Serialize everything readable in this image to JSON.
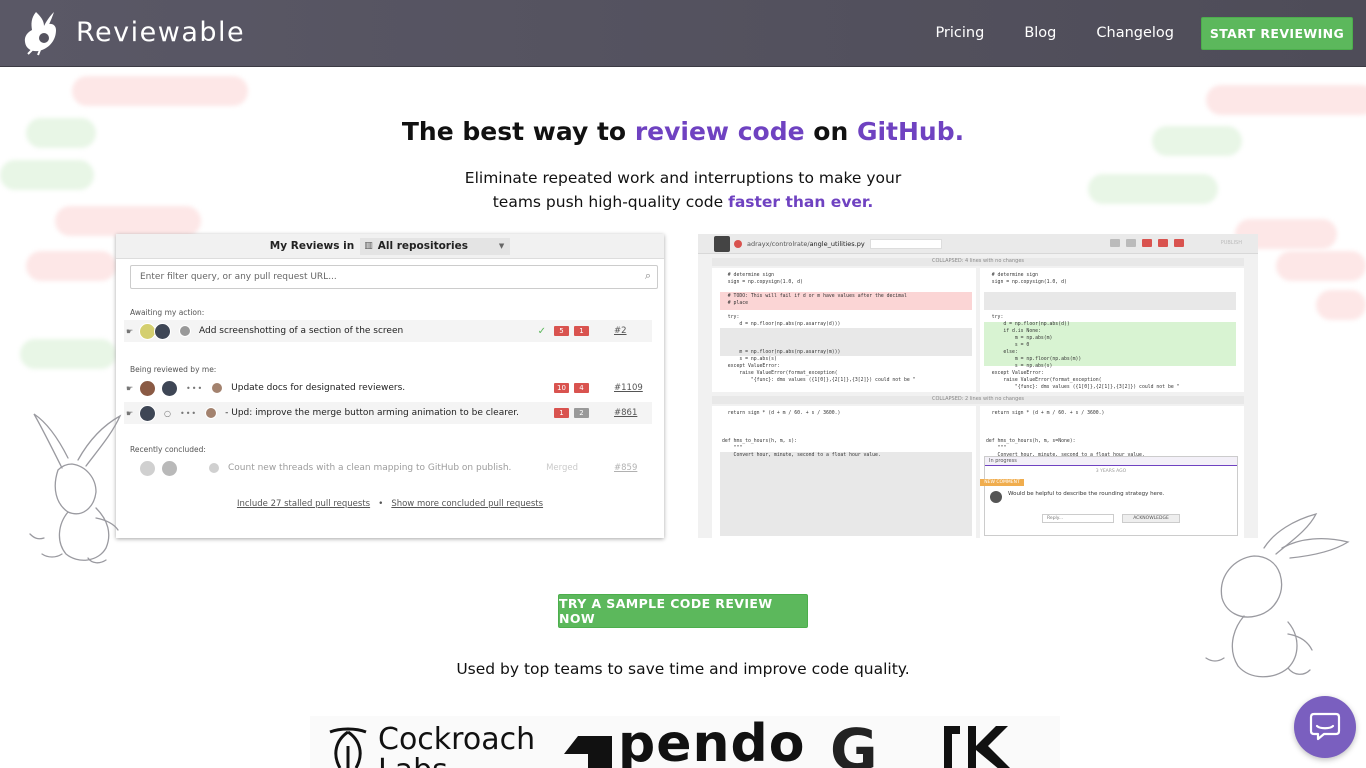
{
  "header": {
    "brand": "Reviewable",
    "nav": [
      {
        "label": "Pricing"
      },
      {
        "label": "Blog"
      },
      {
        "label": "Changelog"
      }
    ],
    "start_button": "START REVIEWING"
  },
  "hero": {
    "title_part1": "The best way to ",
    "title_accent1": "review code",
    "title_part2": " on ",
    "title_accent2": "GitHub.",
    "subtitle_line1": "Eliminate repeated work and interruptions to make your",
    "subtitle_line2_prefix": "teams push high-quality code ",
    "subtitle_accent": "faster than ever."
  },
  "reviews_panel": {
    "heading": "My Reviews in",
    "repo_filter": "All repositories",
    "filter_placeholder": "Enter filter query, or any pull request URL...",
    "sections": {
      "awaiting": "Awaiting my action:",
      "being_reviewed": "Being reviewed by me:",
      "recently_concluded": "Recently concluded:"
    },
    "awaiting_rows": [
      {
        "title": "Add screenshotting of a section of the screen",
        "badge1": "5",
        "badge2": "1",
        "number": "#2"
      }
    ],
    "being_reviewed_rows": [
      {
        "title": "Update docs for designated reviewers.",
        "badge1": "10",
        "badge2": "4",
        "number": "#1109"
      },
      {
        "title": "- Upd: improve the merge button arming animation to be clearer.",
        "badge1": "1",
        "badge2": "2",
        "number": "#861"
      }
    ],
    "concluded_rows": [
      {
        "title": "Count new threads with a clean mapping to GitHub on publish.",
        "status": "Merged",
        "number": "#859"
      }
    ],
    "link_stalled": "Include 27 stalled pull requests",
    "separator": "•",
    "link_more": "Show more concluded pull requests"
  },
  "code_panel": {
    "file_path_prefix": "adrayx/controlrate/",
    "file_name": "angle_utilities.py",
    "publish_label": "PUBLISH",
    "collapsed_1": "COLLAPSED: 4 lines with no changes",
    "collapsed_2": "COLLAPSED: 2 lines with no changes",
    "comment_status": "In progress",
    "time_ago": "3 YEARS AGO",
    "new_comment_label": "NEW COMMENT",
    "comment_text": "Would be helpful to describe the rounding strategy here.",
    "reply_placeholder": "Reply...",
    "acknowledge": "ACKNOWLEDGE",
    "code_left": "  # determine sign\n  sign = np.copysign(1.0, d)\n\n  # TODO: This will fail if d or m have values after the decimal\n  # place\n\n  try:\n      d = np.floor(np.abs(np.asarray(d)))\n\n\n\n      m = np.floor(np.abs(np.asarray(m)))\n      s = np.abs(s)\n  except ValueError:\n      raise ValueError(format_exception(\n          \"{func}: dms values ({1[0]},{2[1]},{3[2]}) could not be \"",
    "code_right": "  # determine sign\n  sign = np.copysign(1.0, d)\n\n\n\n\n  try:\n      d = np.floor(np.abs(d))\n      if d.is None:\n          m = np.abs(m)\n          s = 0\n      else:\n          m = np.floor(np.abs(m))\n          s = np.abs(s)\n  except ValueError:\n      raise ValueError(format_exception(\n          \"{func}: dms values ({1[0]},{2[1]},{3[2]}) could not be \"",
    "code_left_2": "  return sign * (d + m / 60. + s / 3600.)\n\n\n\ndef hms_to_hours(h, m, s):\n    \"\"\"\n    Convert hour, minute, second to a float hour value.",
    "code_right_2": "  return sign * (d + m / 60. + s / 3600.)\n\n\n\ndef hms_to_hours(h, m, s=None):\n    \"\"\"\n    Convert hour, minute, second to a float hour value."
  },
  "cta": {
    "try_button": "TRY A SAMPLE CODE REVIEW NOW",
    "teams_line": "Used by top teams to save time and improve code quality."
  },
  "customer_logos": {
    "cockroach_line1": "Cockroach",
    "cockroach_line2": "Labs",
    "pendo": "pendo",
    "google_letter": "G"
  },
  "colors": {
    "header_bg": "#55535f",
    "accent_purple": "#6f42c1",
    "green_button": "#5cb85c",
    "chat_bubble": "#7a5fbf"
  },
  "icons": [
    "reviewable-logo-icon",
    "search-icon",
    "repo-icon",
    "chat-icon",
    "bunny-illustration-left",
    "bunny-illustration-right"
  ]
}
